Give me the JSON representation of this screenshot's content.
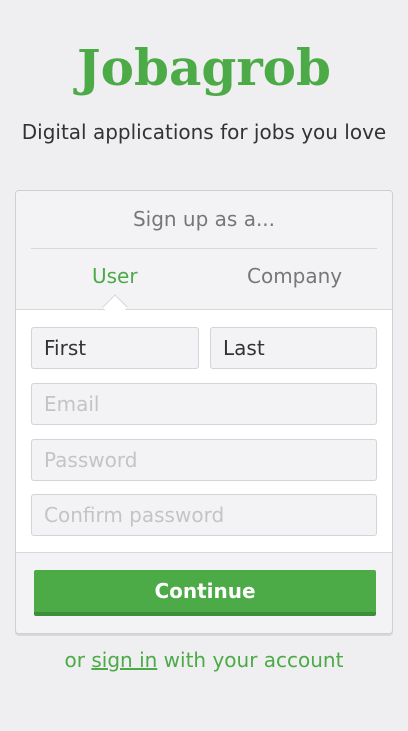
{
  "brand": {
    "logo_text": "Jobagrob",
    "tagline": "Digital applications for jobs you love",
    "accent_color": "#4caa47"
  },
  "signup": {
    "title": "Sign up as a...",
    "tabs": [
      {
        "label": "User",
        "active": true
      },
      {
        "label": "Company",
        "active": false
      }
    ],
    "fields": {
      "first": {
        "value": "First",
        "placeholder": "First"
      },
      "last": {
        "value": "Last",
        "placeholder": "Last"
      },
      "email": {
        "value": "",
        "placeholder": "Email"
      },
      "password": {
        "value": "",
        "placeholder": "Password"
      },
      "confirm": {
        "value": "",
        "placeholder": "Confirm password"
      }
    },
    "continue_label": "Continue"
  },
  "footer": {
    "prefix": "or ",
    "link_label": "sign in",
    "suffix": " with your account"
  }
}
